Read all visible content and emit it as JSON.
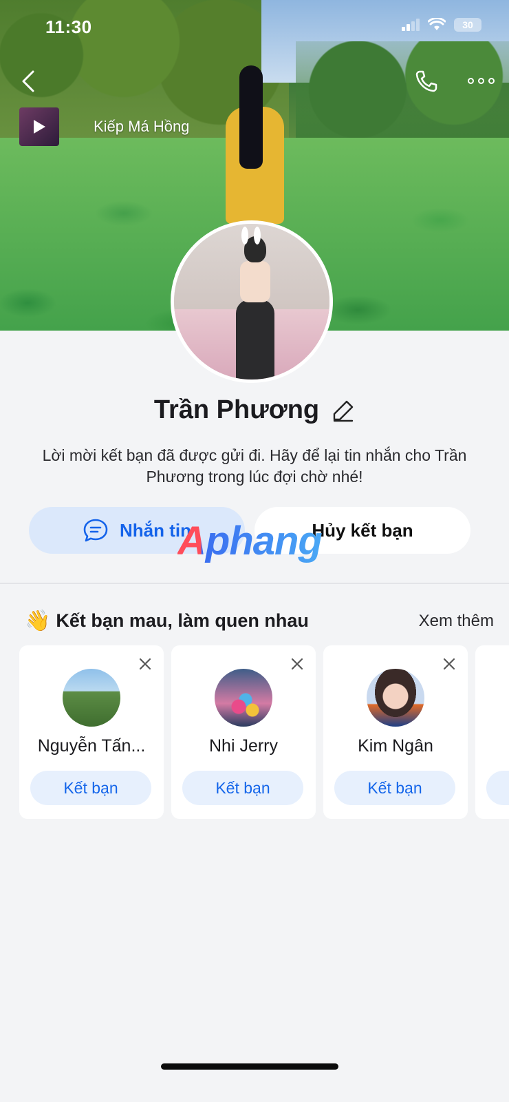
{
  "status_bar": {
    "time": "11:30",
    "battery": "30"
  },
  "cover": {
    "music_title": "Kiếp Má Hồng"
  },
  "profile": {
    "name": "Trần Phương",
    "description": "Lời mời kết bạn đã được gửi đi. Hãy để lại tin nhắn cho Trần Phương trong lúc đợi chờ nhé!"
  },
  "actions": {
    "message_label": "Nhắn tin",
    "unfriend_label": "Hủy kết bạn"
  },
  "watermark": "Aphang",
  "suggestions": {
    "emoji": "👋",
    "title": "Kết bạn mau, làm quen nhau",
    "see_more": "Xem thêm",
    "items": [
      {
        "name": "Nguyễn Tấn...",
        "button": "Kết bạn"
      },
      {
        "name": "Nhi Jerry",
        "button": "Kết bạn"
      },
      {
        "name": "Kim Ngân",
        "button": "Kết bạn"
      }
    ]
  },
  "colors": {
    "accent": "#1463ea",
    "accent_bg": "#dbe8fb",
    "page_bg": "#f3f4f6"
  }
}
